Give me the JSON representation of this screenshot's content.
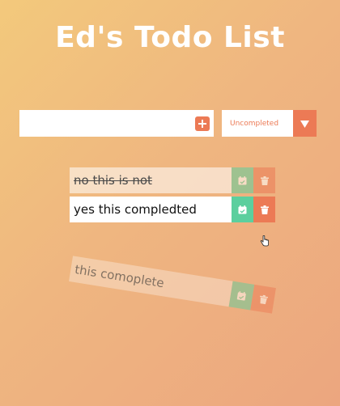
{
  "header": {
    "title": "Ed's Todo List"
  },
  "form": {
    "input_value": "",
    "add_icon": "plus-icon",
    "filter": {
      "selected": "Uncompleted",
      "arrow_icon": "caret-down-icon"
    }
  },
  "todos": [
    {
      "text": "no this is not",
      "completed": true,
      "state": "normal"
    },
    {
      "text": "yes this compledted",
      "completed": false,
      "state": "normal"
    },
    {
      "text": "this comoplete",
      "completed": false,
      "state": "falling"
    }
  ],
  "colors": {
    "accent": "#ec7a55",
    "check": "#5ccf9e",
    "background_start": "#f3c97c",
    "background_end": "#eca67f"
  }
}
